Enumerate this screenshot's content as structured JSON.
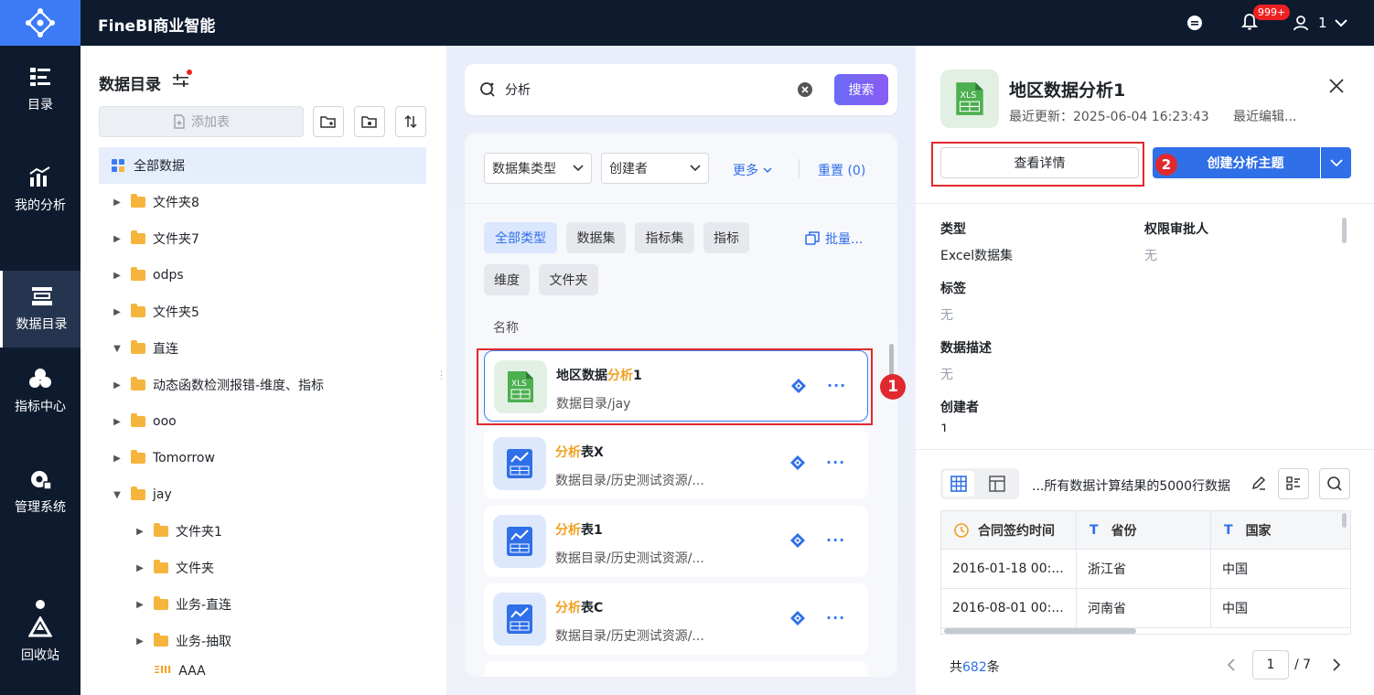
{
  "app": {
    "title": "FineBI商业智能",
    "notification_count": "999+",
    "user": "1"
  },
  "nav": [
    {
      "label": "目录",
      "icon": "catalog-list-icon"
    },
    {
      "label": "我的分析",
      "icon": "analysis-chart-icon"
    },
    {
      "label": "数据目录",
      "icon": "data-catalog-icon"
    },
    {
      "label": "指标中心",
      "icon": "metric-cube-icon"
    },
    {
      "label": "管理系统",
      "icon": "admin-gear-icon"
    },
    {
      "label": "回收站",
      "icon": "recycle-icon"
    }
  ],
  "catalog": {
    "title": "数据目录",
    "add_table": "添加表",
    "all_data": "全部数据",
    "tree": [
      {
        "label": "文件夹8",
        "level": 0,
        "expanded": false
      },
      {
        "label": "文件夹7",
        "level": 0,
        "expanded": false
      },
      {
        "label": "odps",
        "level": 0,
        "expanded": false
      },
      {
        "label": "文件夹5",
        "level": 0,
        "expanded": false
      },
      {
        "label": "直连",
        "level": 0,
        "expanded": true
      },
      {
        "label": "动态函数检测报错-维度、指标",
        "level": 0,
        "expanded": false
      },
      {
        "label": "ooo",
        "level": 0,
        "expanded": false
      },
      {
        "label": "Tomorrow",
        "level": 0,
        "expanded": false
      },
      {
        "label": "jay",
        "level": 0,
        "expanded": true
      },
      {
        "label": "文件夹1",
        "level": 1,
        "expanded": false
      },
      {
        "label": "文件夹",
        "level": 1,
        "expanded": false
      },
      {
        "label": "业务-直连",
        "level": 1,
        "expanded": false
      },
      {
        "label": "业务-抽取",
        "level": 1,
        "expanded": false
      },
      {
        "label": "AAA",
        "level": 1,
        "expanded": false
      }
    ]
  },
  "search": {
    "query": "分析",
    "button": "搜索"
  },
  "filters": {
    "dataset_type": "数据集类型",
    "creator": "创建者",
    "more": "更多",
    "reset": "重置 (0)",
    "chips": [
      "全部类型",
      "数据集",
      "指标集",
      "指标",
      "维度",
      "文件夹"
    ],
    "batch": "批量...",
    "column_header": "名称"
  },
  "results": [
    {
      "title_pre": "地区数据",
      "title_hl": "分析",
      "title_post": "1",
      "path": "数据目录/jay",
      "type": "excel"
    },
    {
      "title_pre": "",
      "title_hl": "分析",
      "title_post": "表X",
      "path": "数据目录/历史测试资源/...",
      "type": "analysis"
    },
    {
      "title_pre": "",
      "title_hl": "分析",
      "title_post": "表1",
      "path": "数据目录/历史测试资源/...",
      "type": "analysis"
    },
    {
      "title_pre": "",
      "title_hl": "分析",
      "title_post": "表C",
      "path": "数据目录/历史测试资源/...",
      "type": "analysis"
    }
  ],
  "annotations": {
    "step1": "1",
    "step2": "2"
  },
  "detail": {
    "title": "地区数据分析1",
    "updated": "最近更新：2025-06-04 16:23:43",
    "last_edit": "最近编辑...",
    "view_detail": "查看详情",
    "create_topic": "创建分析主题",
    "fields": {
      "type_label": "类型",
      "type_value": "Excel数据集",
      "approver_label": "权限审批人",
      "approver_value": "无",
      "tag_label": "标签",
      "tag_value": "无",
      "desc_label": "数据描述",
      "desc_value": "无",
      "creator_label": "创建者",
      "creator_value": "1"
    },
    "preview_note": "...所有数据计算结果的5000行数据",
    "table": {
      "headers": [
        "合同签约时间",
        "省份",
        "国家"
      ],
      "rows": [
        [
          "2016-01-18 00:...",
          "浙江省",
          "中国"
        ],
        [
          "2016-08-01 00:...",
          "河南省",
          "中国"
        ]
      ]
    },
    "total_prefix": "共",
    "total_count": "682",
    "total_suffix": "条",
    "page": "1",
    "page_total": "/ 7"
  }
}
